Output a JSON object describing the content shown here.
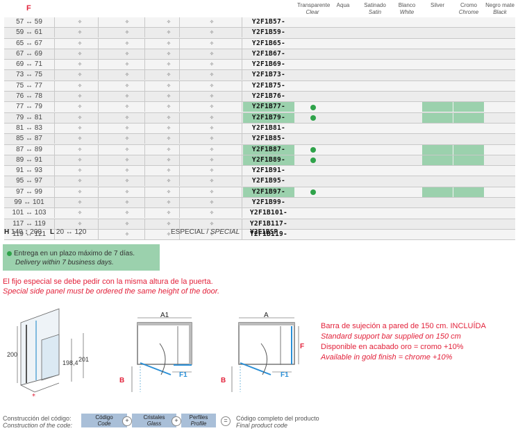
{
  "header": {
    "f_label": "F",
    "columns": [
      {
        "es": "Transparente",
        "en": "Clear"
      },
      {
        "es": "Aqua",
        "en": ""
      },
      {
        "es": "Satinado",
        "en": "Satin"
      },
      {
        "es": "Blanco",
        "en": "White"
      },
      {
        "es": "Silver",
        "en": ""
      },
      {
        "es": "Cromo",
        "en": "Chrome"
      },
      {
        "es": "Negro mate",
        "en": "Black"
      }
    ]
  },
  "table": {
    "diamond": "✧",
    "rows": [
      {
        "size": "57 ↔ 59",
        "code": "Y2F1B57-",
        "avail": false
      },
      {
        "size": "59 ↔ 61",
        "code": "Y2F1B59-",
        "avail": false
      },
      {
        "size": "65 ↔ 67",
        "code": "Y2F1B65-",
        "avail": false
      },
      {
        "size": "67 ↔ 69",
        "code": "Y2F1B67-",
        "avail": false
      },
      {
        "size": "69 ↔ 71",
        "code": "Y2F1B69-",
        "avail": false
      },
      {
        "size": "73 ↔ 75",
        "code": "Y2F1B73-",
        "avail": false
      },
      {
        "size": "75 ↔ 77",
        "code": "Y2F1B75-",
        "avail": false
      },
      {
        "size": "76 ↔ 78",
        "code": "Y2F1B76-",
        "avail": false
      },
      {
        "size": "77 ↔ 79",
        "code": "Y2F1B77-",
        "avail": true
      },
      {
        "size": "79 ↔ 81",
        "code": "Y2F1B79-",
        "avail": true
      },
      {
        "size": "81 ↔ 83",
        "code": "Y2F1B81-",
        "avail": false
      },
      {
        "size": "85 ↔ 87",
        "code": "Y2F1B85-",
        "avail": false
      },
      {
        "size": "87 ↔ 89",
        "code": "Y2F1B87-",
        "avail": true
      },
      {
        "size": "89 ↔ 91",
        "code": "Y2F1B89-",
        "avail": true
      },
      {
        "size": "91 ↔ 93",
        "code": "Y2F1B91-",
        "avail": false
      },
      {
        "size": "95 ↔ 97",
        "code": "Y2F1B95-",
        "avail": false
      },
      {
        "size": "97 ↔ 99",
        "code": "Y2F1B97-",
        "avail": true
      },
      {
        "size": "99 ↔ 101",
        "code": "Y2F1B99-",
        "avail": false
      },
      {
        "size": "101 ↔ 103",
        "code": "Y2F1B101-",
        "avail": false
      },
      {
        "size": "117 ↔ 119",
        "code": "Y2F1B117-",
        "avail": false
      },
      {
        "size": "119 ↔ 121",
        "code": "Y2F1B119-",
        "avail": false
      }
    ]
  },
  "footer": {
    "h_label": "H",
    "h_value": "140 ↕ 200",
    "l_label": "L",
    "l_value": "20 ↔ 120",
    "special_es": "ESPECIAL /",
    "special_en": "SPECIAL",
    "special_code": "Y2F1BSP"
  },
  "note": {
    "es": "Entrega en un plazo máximo de 7 días.",
    "en": "Delivery within 7 business days."
  },
  "warning": {
    "es": "El fijo especial se debe pedir con la misma altura de la puerta.",
    "en": "Special side panel must be ordered the same height of the door."
  },
  "diagram": {
    "h200": "200",
    "h198": "198,4",
    "h201": "201",
    "a1": "A1",
    "f1": "F1",
    "b": "B",
    "a": "A",
    "f": "F",
    "f1b": "F1",
    "b2": "B"
  },
  "bar_info": {
    "line1": "Barra de sujeción a pared de 150 cm. INCLUÍDA",
    "line2": "Standard support bar supplied on 150 cm",
    "line3": "Disponible en acabado oro = cromo +10%",
    "line4": "Available in gold finish = chrome +10%"
  },
  "legend": {
    "label_es": "Construcción del código:",
    "label_en": "Construction of the code:",
    "pill1_es": "Código",
    "pill1_en": "Code",
    "pill2_es": "Cristales",
    "pill2_en": "Glass",
    "pill3_es": "Perfiles",
    "pill3_en": "Profile",
    "plus": "+",
    "equals": "=",
    "result_es": "Código completo del producto",
    "result_en": "Final product code"
  },
  "colors": {
    "green": "#2fa34a",
    "highlight": "#9bd1ad",
    "red": "#e2213a",
    "pill": "#a9bfd8"
  }
}
